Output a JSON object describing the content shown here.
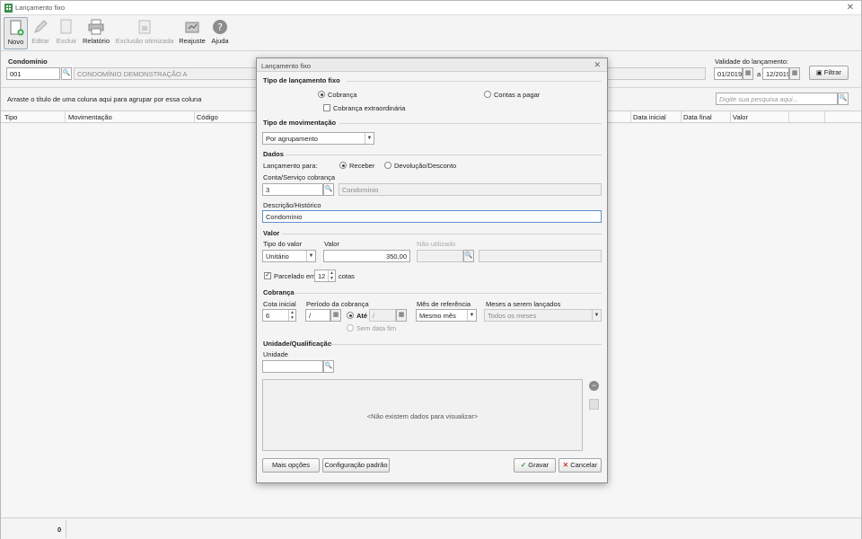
{
  "window": {
    "title": "Lançamento fixo"
  },
  "toolbar": {
    "novo": "Novo",
    "editar": "Editar",
    "excluir": "Excluir",
    "relatorio": "Relatório",
    "exclusao_otimizada": "Exclusão otimizada",
    "reajuste": "Reajuste",
    "ajuda": "Ajuda"
  },
  "filter": {
    "condominio_label": "Condomínio",
    "condominio_code": "001",
    "condominio_name": "CONDOMÍNIO DEMONSTRAÇÃO A",
    "validade_label": "Validade do lançamento:",
    "validade_from": "01/2019",
    "validade_sep": "a",
    "validade_to": "12/2019",
    "filtrar": "Filtrar",
    "group_hint": "Arraste o título de uma coluna aqui para agrupar por essa coluna",
    "search_placeholder": "Digite sua pesquisa aqui..."
  },
  "grid": {
    "columns": [
      "Tipo",
      "Movimentação",
      "Código",
      "Data inicial",
      "Data final",
      "Valor"
    ]
  },
  "status": {
    "count": "0"
  },
  "dialog": {
    "title": "Lançamento fixo",
    "tipo_lancamento": {
      "heading": "Tipo de lançamento fixo",
      "cobranca": "Cobrança",
      "contas_a_pagar": "Contas a pagar",
      "cobranca_extra": "Cobrança extraordinária"
    },
    "tipo_movimentacao": {
      "heading": "Tipo de movimentação",
      "value": "Por agrupamento"
    },
    "dados": {
      "heading": "Dados",
      "lancamento_para": "Lançamento para:",
      "receber": "Receber",
      "devolucao": "Devolução/Desconto",
      "conta_label": "Conta/Serviço cobrança",
      "conta_code": "3",
      "conta_name": "Condomínio",
      "descricao_label": "Descrição/Histórico",
      "descricao_value": "Condomínio"
    },
    "valor": {
      "heading": "Valor",
      "tipo_label": "Tipo do valor",
      "tipo_value": "Unitário",
      "valor_label": "Valor",
      "valor_value": "350,00",
      "nao_utilizado": "Não utilizado",
      "parcelado_label": "Parcelado em",
      "parcelas": "12",
      "cotas": "cotas"
    },
    "cobranca": {
      "heading": "Cobrança",
      "cota_label": "Cota inicial",
      "cota_value": "6",
      "periodo_label": "Período da cobrança",
      "periodo_from": "/",
      "ate": "Até",
      "periodo_to": "/",
      "sem_data_fim": "Sem data fim",
      "mes_ref_label": "Mês de referência",
      "mes_ref_value": "Mesmo mês",
      "meses_label": "Meses a serem lançados",
      "meses_value": "Todos os meses"
    },
    "unidade": {
      "heading": "Unidade/Qualificação",
      "unidade_label": "Unidade",
      "empty": "<Não existem dados para visualizar>"
    },
    "buttons": {
      "mais_opcoes": "Mais opções",
      "config_padrao": "Configuração padrão",
      "gravar": "Gravar",
      "cancelar": "Cancelar"
    }
  }
}
